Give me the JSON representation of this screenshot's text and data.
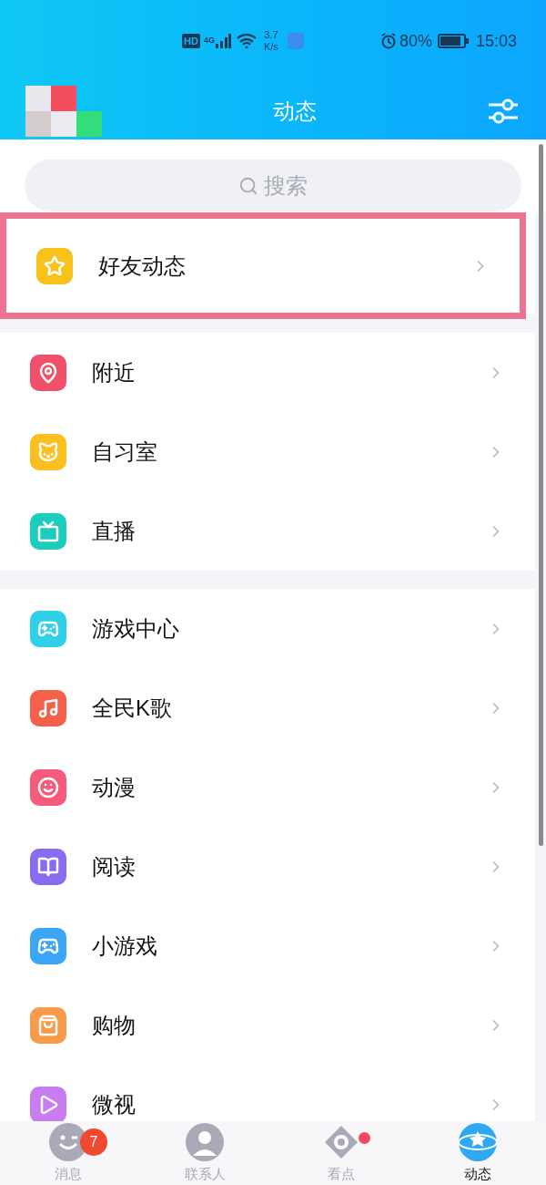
{
  "status_bar": {
    "hd": "HD",
    "network": "4G",
    "speed_value": "3.7",
    "speed_unit": "K/s",
    "battery": "80%",
    "time": "15:03"
  },
  "header": {
    "title": "动态"
  },
  "search": {
    "placeholder": "搜索"
  },
  "sections": [
    {
      "items": [
        {
          "label": "好友动态",
          "color": "#f7c21a",
          "highlighted": true
        }
      ]
    },
    {
      "items": [
        {
          "label": "附近",
          "color": "#f0506a",
          "highlighted": false
        },
        {
          "label": "自习室",
          "color": "#fbbf1f",
          "highlighted": false
        },
        {
          "label": "直播",
          "color": "#1ccdbd",
          "highlighted": false
        }
      ]
    },
    {
      "items": [
        {
          "label": "游戏中心",
          "color": "#2fd0e8",
          "highlighted": false
        },
        {
          "label": "全民K歌",
          "color": "#f4604a",
          "highlighted": false
        },
        {
          "label": "动漫",
          "color": "#f55b7b",
          "highlighted": false
        },
        {
          "label": "阅读",
          "color": "#8a6cf0",
          "highlighted": false
        },
        {
          "label": "小游戏",
          "color": "#3aa6f5",
          "highlighted": false
        },
        {
          "label": "购物",
          "color": "#f79a4a",
          "highlighted": false
        },
        {
          "label": "微视",
          "color": "#c77cf0",
          "highlighted": false
        }
      ]
    }
  ],
  "bottom_nav": [
    {
      "label": "消息",
      "selected": false,
      "badge": "7"
    },
    {
      "label": "联系人",
      "selected": false
    },
    {
      "label": "看点",
      "selected": false,
      "dot": true
    },
    {
      "label": "动态",
      "selected": true
    }
  ]
}
